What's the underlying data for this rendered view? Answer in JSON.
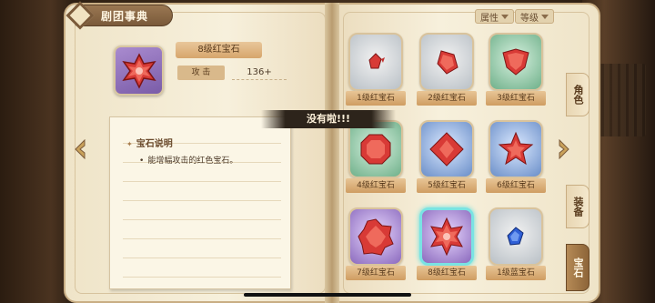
{
  "header": {
    "title": "剧团事典"
  },
  "filters": [
    {
      "label": "属性"
    },
    {
      "label": "等级"
    }
  ],
  "detail": {
    "name": "8级红宝石",
    "stat_label": "攻 击",
    "stat_value": "136+",
    "section_title": "宝石说明",
    "description": "能增幅攻击的红色宝石。"
  },
  "toast": "没有啦!!!",
  "gems": [
    {
      "label": "1级红宝石",
      "bg": "gray",
      "gem": "red-small"
    },
    {
      "label": "2级红宝石",
      "bg": "gray",
      "gem": "red-diamond"
    },
    {
      "label": "3级红宝石",
      "bg": "green",
      "gem": "red-shield"
    },
    {
      "label": "4级红宝石",
      "bg": "green",
      "gem": "red-octagon"
    },
    {
      "label": "5级红宝石",
      "bg": "blue",
      "gem": "red-square"
    },
    {
      "label": "6级红宝石",
      "bg": "blue",
      "gem": "red-star"
    },
    {
      "label": "7级红宝石",
      "bg": "purple",
      "gem": "red-heptagon"
    },
    {
      "label": "8级红宝石",
      "bg": "purple-selected",
      "gem": "red-star8"
    },
    {
      "label": "1级蓝宝石",
      "bg": "gray",
      "gem": "blue-small"
    }
  ],
  "side_tabs": [
    {
      "label": "角色",
      "active": false
    },
    {
      "label": "装备",
      "active": false
    },
    {
      "label": "宝石",
      "active": true
    }
  ],
  "colors": {
    "gem_red": "#d83a36",
    "gem_blue": "#2f5fd6",
    "selected_glow": "#7ae3e3",
    "active_tab": "#8d6539"
  }
}
